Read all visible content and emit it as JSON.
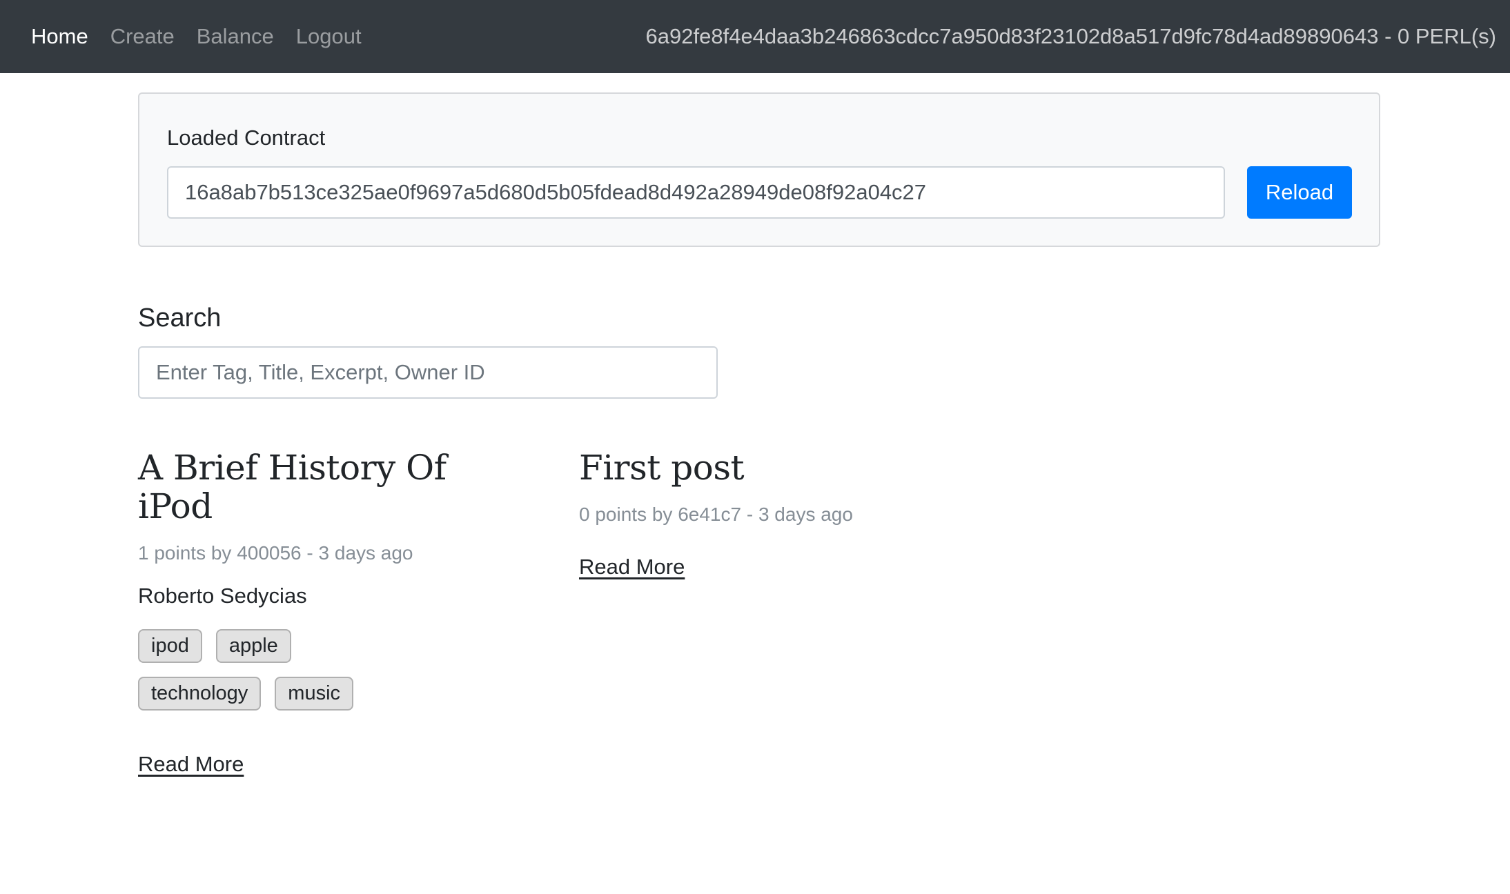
{
  "navbar": {
    "links": [
      {
        "label": "Home",
        "active": true
      },
      {
        "label": "Create",
        "active": false
      },
      {
        "label": "Balance",
        "active": false
      },
      {
        "label": "Logout",
        "active": false
      }
    ],
    "account": "6a92fe8f4e4daa3b246863cdcc7a950d83f23102d8a517d9fc78d4ad89890643 - 0 PERL(s)"
  },
  "contract": {
    "label": "Loaded Contract",
    "value": "16a8ab7b513ce325ae0f9697a5d680d5b05fdead8d492a28949de08f92a04c27",
    "reload_label": "Reload"
  },
  "search": {
    "label": "Search",
    "placeholder": "Enter Tag, Title, Excerpt, Owner ID",
    "value": ""
  },
  "posts": [
    {
      "title": "A Brief History Of iPod",
      "meta": "1 points by 400056 - 3 days ago",
      "author": "Roberto Sedycias",
      "tags": [
        "ipod",
        "apple",
        "technology",
        "music"
      ],
      "read_more": "Read More"
    },
    {
      "title": "First post",
      "meta": "0 points by 6e41c7 - 3 days ago",
      "read_more": "Read More"
    }
  ],
  "colors": {
    "navbar_bg": "#343a40",
    "primary": "#007bff",
    "card_bg": "#f8f9fa",
    "meta_text": "#868e96"
  }
}
